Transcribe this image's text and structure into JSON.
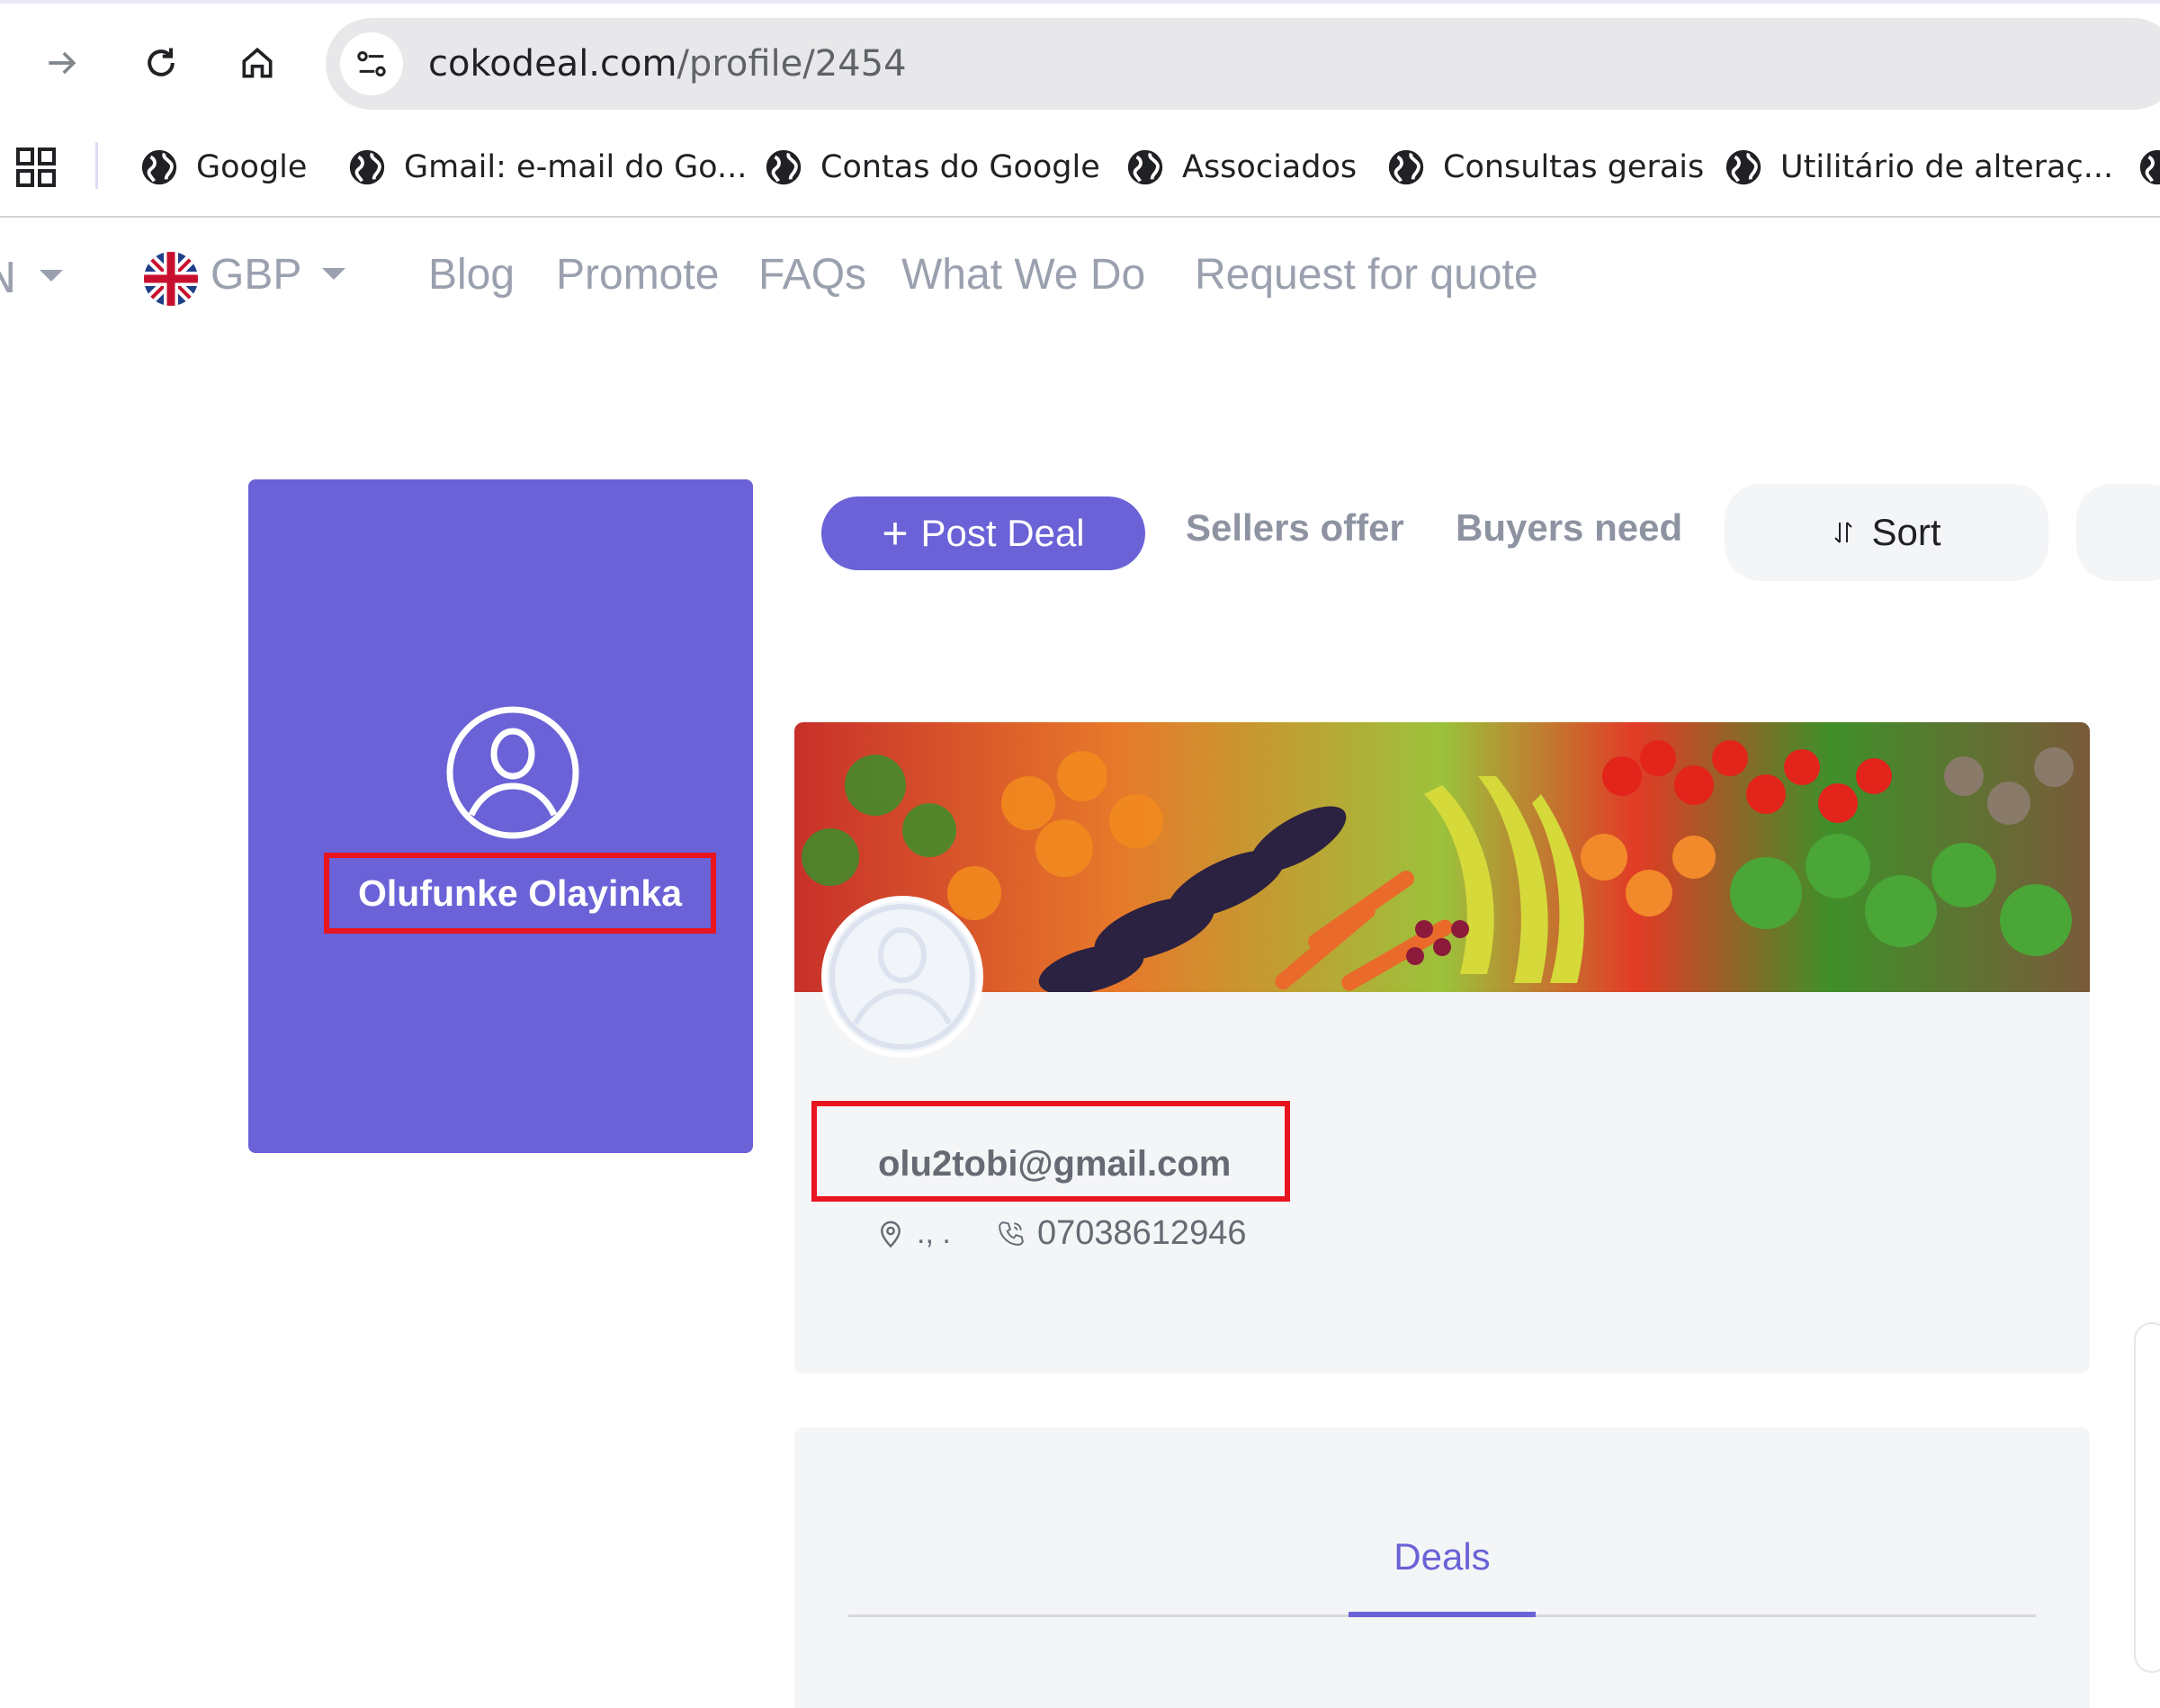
{
  "browser": {
    "url_host": "cokodeal.com",
    "url_path": "/profile/2454",
    "nav_icons": [
      "forward-arrow-icon",
      "reload-icon",
      "home-icon",
      "site-info-icon"
    ]
  },
  "bookmarks": [
    {
      "label": "Google"
    },
    {
      "label": "Gmail: e-mail do Go..."
    },
    {
      "label": "Contas do Google"
    },
    {
      "label": "Associados"
    },
    {
      "label": "Consultas gerais"
    },
    {
      "label": "Utilitário de alteraç..."
    }
  ],
  "site_nav": {
    "language_fragment": "N",
    "currency": "GBP",
    "links": [
      "Blog",
      "Promote",
      "FAQs",
      "What We Do",
      "Request for quote"
    ]
  },
  "profile": {
    "name": "Olufunke Olayinka",
    "email": "olu2tobi@gmail.com",
    "location": "., .",
    "phone": "07038612946"
  },
  "actions": {
    "post_deal_plus": "+",
    "post_deal": "Post Deal",
    "sellers_offer": "Sellers offer",
    "buyers_need": "Buyers need",
    "sort": "Sort"
  },
  "tabs": {
    "deals": "Deals"
  },
  "colors": {
    "brand": "#6a62d6",
    "highlight": "#e8141f",
    "muted": "#9aa0ae",
    "panel": "#f4f5f7"
  }
}
